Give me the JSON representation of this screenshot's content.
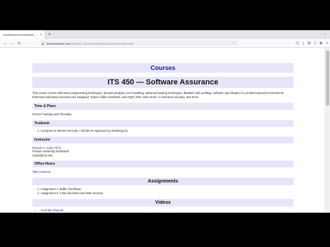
{
  "browser": {
    "tab_title": "ccsoftassurance/software_assurance",
    "url_host": "its.ethicalcode.com",
    "url_path": "/software_assurance/software-assurance/index.html"
  },
  "page": {
    "banner": "Courses",
    "title": "ITS 450 — Software Assurance",
    "description": "This course covers defensive programming techniques, bounds analysis, error handling, advanced testing techniques, detailed code auditing, software specification in a trusted-assured environment. Extensive laboratory exercises are assigned. Topics: buffer overflows, web-SQP, XSS, web errors, e-commerce security, and more.",
    "sections": {
      "time_place": {
        "heading": "Time & Place",
        "text": "6-9 pm Tuesday and Thursday"
      },
      "textbook": {
        "heading": "Textbook",
        "items": [
          "Computer & Internet Security: A hands-on Approach by Wenliang Du"
        ]
      },
      "instructor": {
        "heading": "Instructor",
        "name": "Ricardo A. Calix, Ph.D.",
        "affiliation": "Purdue University Northwest",
        "email": "rcalix@pnw.edu"
      },
      "office_hours": {
        "heading": "Office Hours",
        "text": "TBD Anderson"
      },
      "assignments": {
        "heading": "Assignments",
        "items": [
          "Assignment 1: Buffer Overflows",
          "Assignment 2: Code Injections and Web Security"
        ]
      },
      "videos": {
        "heading": "Videos",
        "items": [
          "YouTube Channel"
        ]
      }
    }
  }
}
